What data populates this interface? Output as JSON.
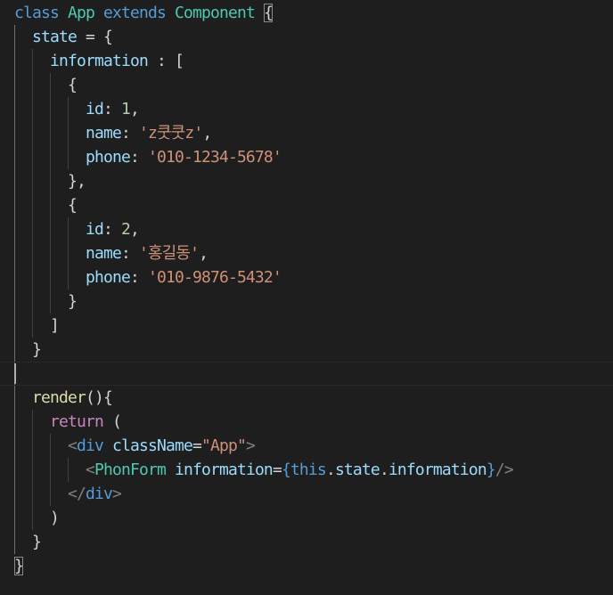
{
  "editor": {
    "lines": [
      {
        "tokens": [
          {
            "text": "class",
            "kind": "keyword"
          },
          {
            "text": " App",
            "kind": "type"
          },
          {
            "text": " extends",
            "kind": "keyword"
          },
          {
            "text": " Component ",
            "kind": "type"
          },
          {
            "text": "{",
            "kind": "plain",
            "match": true
          }
        ]
      },
      {
        "tokens": [
          {
            "text": "  state",
            "kind": "variable"
          },
          {
            "text": " = {",
            "kind": "plain"
          }
        ]
      },
      {
        "tokens": [
          {
            "text": "    information",
            "kind": "variable"
          },
          {
            "text": " : [",
            "kind": "plain"
          }
        ]
      },
      {
        "tokens": [
          {
            "text": "      {",
            "kind": "plain"
          }
        ]
      },
      {
        "tokens": [
          {
            "text": "        id",
            "kind": "variable"
          },
          {
            "text": ": ",
            "kind": "plain"
          },
          {
            "text": "1",
            "kind": "number"
          },
          {
            "text": ",",
            "kind": "plain"
          }
        ]
      },
      {
        "tokens": [
          {
            "text": "        name",
            "kind": "variable"
          },
          {
            "text": ": ",
            "kind": "plain"
          },
          {
            "text": "'z쿳쿳z'",
            "kind": "string"
          },
          {
            "text": ",",
            "kind": "plain"
          }
        ]
      },
      {
        "tokens": [
          {
            "text": "        phone",
            "kind": "variable"
          },
          {
            "text": ": ",
            "kind": "plain"
          },
          {
            "text": "'010-1234-5678'",
            "kind": "string"
          }
        ]
      },
      {
        "tokens": [
          {
            "text": "      },",
            "kind": "plain"
          }
        ]
      },
      {
        "tokens": [
          {
            "text": "      {",
            "kind": "plain"
          }
        ]
      },
      {
        "tokens": [
          {
            "text": "        id",
            "kind": "variable"
          },
          {
            "text": ": ",
            "kind": "plain"
          },
          {
            "text": "2",
            "kind": "number"
          },
          {
            "text": ",",
            "kind": "plain"
          }
        ]
      },
      {
        "tokens": [
          {
            "text": "        name",
            "kind": "variable"
          },
          {
            "text": ": ",
            "kind": "plain"
          },
          {
            "text": "'홍길동'",
            "kind": "string"
          },
          {
            "text": ",",
            "kind": "plain"
          }
        ]
      },
      {
        "tokens": [
          {
            "text": "        phone",
            "kind": "variable"
          },
          {
            "text": ": ",
            "kind": "plain"
          },
          {
            "text": "'010-9876-5432'",
            "kind": "string"
          }
        ]
      },
      {
        "tokens": [
          {
            "text": "      }",
            "kind": "plain"
          }
        ]
      },
      {
        "tokens": [
          {
            "text": "    ]",
            "kind": "plain"
          }
        ]
      },
      {
        "tokens": [
          {
            "text": "  }",
            "kind": "plain"
          }
        ]
      },
      {
        "tokens": [],
        "current": true
      },
      {
        "tokens": [
          {
            "text": "  render",
            "kind": "function"
          },
          {
            "text": "(){",
            "kind": "plain"
          }
        ]
      },
      {
        "tokens": [
          {
            "text": "    return",
            "kind": "control"
          },
          {
            "text": " (",
            "kind": "plain"
          }
        ]
      },
      {
        "tokens": [
          {
            "text": "      <",
            "kind": "punct"
          },
          {
            "text": "div",
            "kind": "keyword"
          },
          {
            "text": " className",
            "kind": "variable"
          },
          {
            "text": "=",
            "kind": "plain"
          },
          {
            "text": "\"App\"",
            "kind": "string"
          },
          {
            "text": ">",
            "kind": "punct"
          }
        ]
      },
      {
        "tokens": [
          {
            "text": "        <",
            "kind": "punct"
          },
          {
            "text": "PhonForm",
            "kind": "type"
          },
          {
            "text": " information",
            "kind": "variable"
          },
          {
            "text": "=",
            "kind": "plain"
          },
          {
            "text": "{",
            "kind": "keyword"
          },
          {
            "text": "this",
            "kind": "keyword"
          },
          {
            "text": ".",
            "kind": "plain"
          },
          {
            "text": "state",
            "kind": "variable"
          },
          {
            "text": ".",
            "kind": "plain"
          },
          {
            "text": "information",
            "kind": "variable"
          },
          {
            "text": "}",
            "kind": "keyword"
          },
          {
            "text": "/>",
            "kind": "punct"
          }
        ]
      },
      {
        "tokens": [
          {
            "text": "      </",
            "kind": "punct"
          },
          {
            "text": "div",
            "kind": "keyword"
          },
          {
            "text": ">",
            "kind": "punct"
          }
        ]
      },
      {
        "tokens": [
          {
            "text": "    )",
            "kind": "plain"
          }
        ]
      },
      {
        "tokens": [
          {
            "text": "  }",
            "kind": "plain"
          }
        ]
      },
      {
        "tokens": [
          {
            "text": "}",
            "kind": "plain",
            "match": true
          }
        ]
      }
    ]
  },
  "colors": {
    "background": "#1e1e1e",
    "plain": "#d4d4d4",
    "keyword": "#569cd6",
    "type": "#4ec9b0",
    "variable": "#9cdcfe",
    "number": "#b5cea8",
    "string": "#ce9178",
    "function": "#dcdcaa",
    "control": "#c586c0",
    "punct": "#808080",
    "indent_guide": "#404040",
    "indent_guide_active": "#707070",
    "cursor": "#aeafad",
    "current_line_border": "#282828"
  }
}
